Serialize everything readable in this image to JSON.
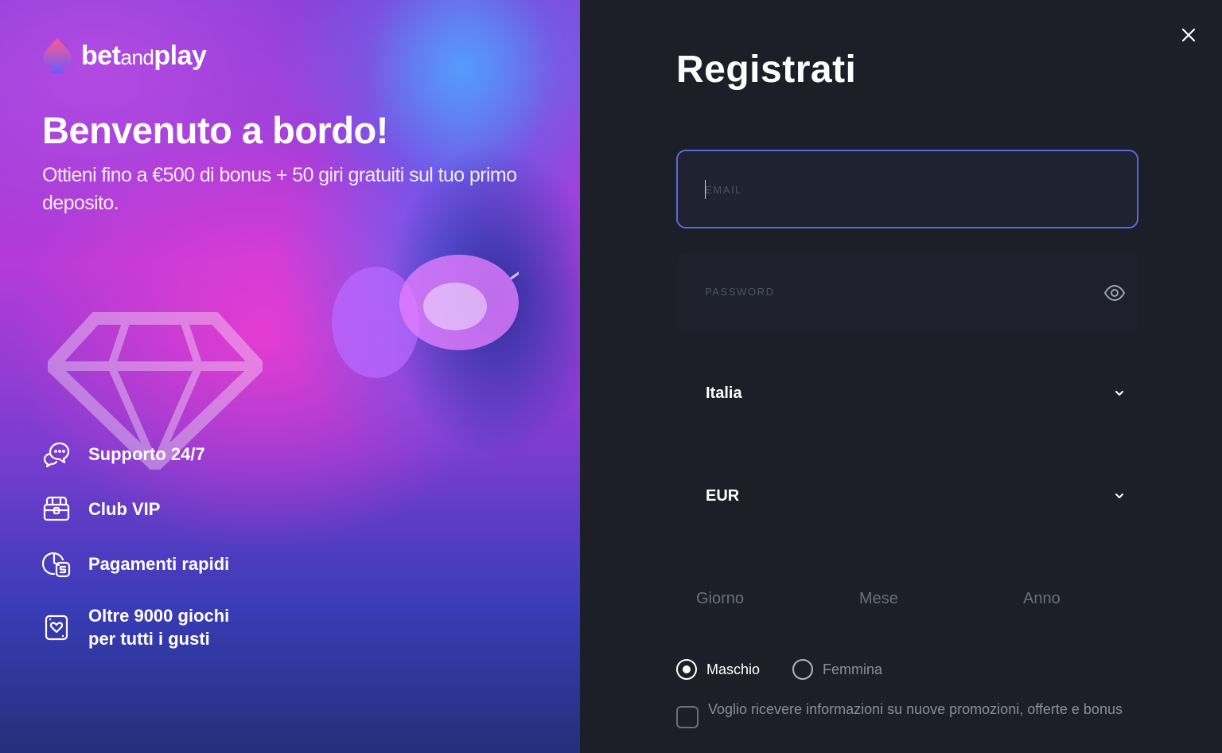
{
  "brand": {
    "name_part1": "bet",
    "name_part2": "and",
    "name_part3": "play"
  },
  "hero": {
    "title": "Benvenuto a bordo!",
    "subtitle": "Ottieni fino a €500 di bonus + 50 giri gratuiti sul tuo primo deposito."
  },
  "features": [
    {
      "icon": "chat-support-icon",
      "label": "Supporto 24/7"
    },
    {
      "icon": "vip-chest-icon",
      "label": "Club VIP"
    },
    {
      "icon": "fast-payment-icon",
      "label": "Pagamenti rapidi"
    },
    {
      "icon": "card-games-icon",
      "label": "Oltre 9000 giochi\nper tutti i gusti"
    }
  ],
  "form": {
    "title": "Registrati",
    "email_placeholder": "EMAIL",
    "password_placeholder": "PASSWORD",
    "country_value": "Italia",
    "currency_value": "EUR",
    "dob": {
      "day": "Giorno",
      "month": "Mese",
      "year": "Anno"
    },
    "gender": {
      "male": "Maschio",
      "female": "Femmina",
      "selected": "male"
    },
    "promo_checkbox_label": "Voglio ricevere informazioni su nuove promozioni, offerte e bonus"
  },
  "colors": {
    "accent": "#5b66e0",
    "panel": "#1c1f27"
  }
}
